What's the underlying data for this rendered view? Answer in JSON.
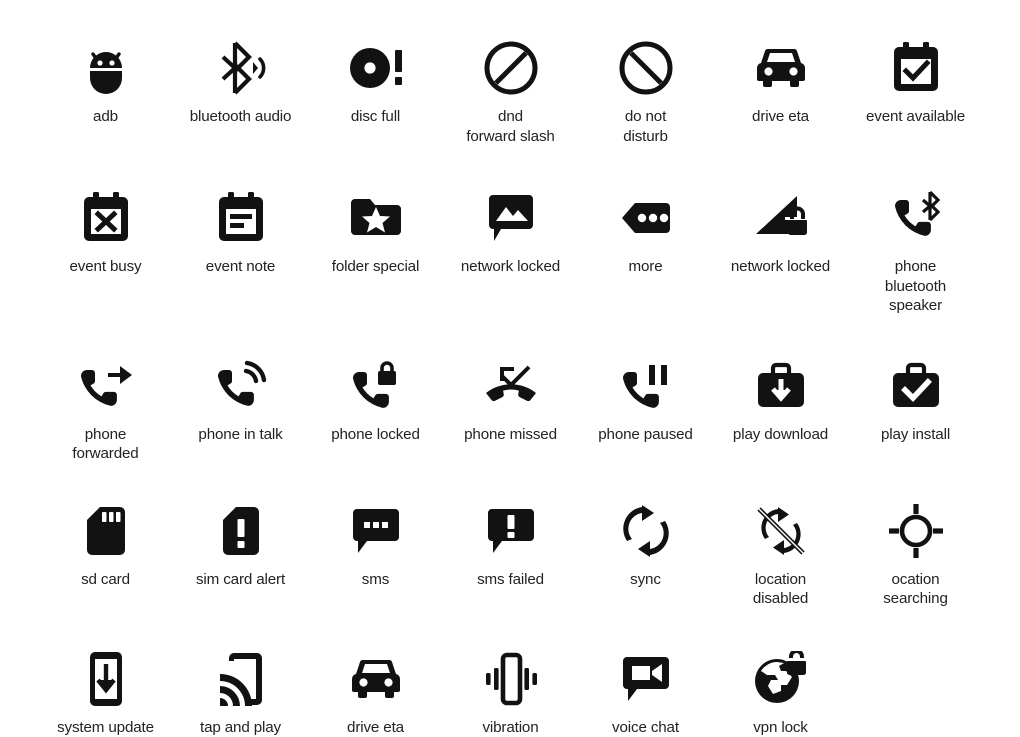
{
  "sheet": {
    "background": "#ffffff",
    "icon_color": "#121212",
    "caption_color": "#232323",
    "columns": 7,
    "rows": 5
  },
  "rows": [
    {
      "items": [
        {
          "icon": "adb-icon",
          "label": "adb"
        },
        {
          "icon": "bluetooth-audio-icon",
          "label": "bluetooth audio"
        },
        {
          "icon": "disc-full-icon",
          "label": "disc full"
        },
        {
          "icon": "dnd-forward-slash-icon",
          "label": "dnd\nforward slash"
        },
        {
          "icon": "do-not-disturb-icon",
          "label": "do not\ndisturb"
        },
        {
          "icon": "drive-eta-icon",
          "label": "drive eta"
        },
        {
          "icon": "event-available-icon",
          "label": "event available"
        }
      ]
    },
    {
      "items": [
        {
          "icon": "event-busy-icon",
          "label": "event busy"
        },
        {
          "icon": "event-note-icon",
          "label": "event note"
        },
        {
          "icon": "folder-special-icon",
          "label": "folder special"
        },
        {
          "icon": "network-locked-image-icon",
          "label": "network locked"
        },
        {
          "icon": "more-icon",
          "label": "more"
        },
        {
          "icon": "network-locked-signal-icon",
          "label": "network locked"
        },
        {
          "icon": "phone-bluetooth-speaker-icon",
          "label": "phone\nbluetooth\nspeaker"
        }
      ]
    },
    {
      "items": [
        {
          "icon": "phone-forwarded-icon",
          "label": "phone\nforwarded"
        },
        {
          "icon": "phone-in-talk-icon",
          "label": "phone in talk"
        },
        {
          "icon": "phone-locked-icon",
          "label": "phone locked"
        },
        {
          "icon": "phone-missed-icon",
          "label": "phone missed"
        },
        {
          "icon": "phone-paused-icon",
          "label": "phone paused"
        },
        {
          "icon": "play-download-icon",
          "label": "play download"
        },
        {
          "icon": "play-install-icon",
          "label": "play install"
        }
      ]
    },
    {
      "items": [
        {
          "icon": "sd-card-icon",
          "label": "sd card"
        },
        {
          "icon": "sim-card-alert-icon",
          "label": "sim card alert"
        },
        {
          "icon": "sms-icon",
          "label": "sms"
        },
        {
          "icon": "sms-failed-icon",
          "label": "sms failed"
        },
        {
          "icon": "sync-icon",
          "label": "sync"
        },
        {
          "icon": "location-disabled-icon",
          "label": "location\ndisabled"
        },
        {
          "icon": "location-searching-icon",
          "label": "ocation\nsearching"
        }
      ]
    },
    {
      "items": [
        {
          "icon": "system-update-icon",
          "label": "system update"
        },
        {
          "icon": "tap-and-play-icon",
          "label": "tap and play"
        },
        {
          "icon": "drive-eta-icon",
          "label": "drive eta"
        },
        {
          "icon": "vibration-icon",
          "label": "vibration"
        },
        {
          "icon": "voice-chat-icon",
          "label": "voice chat"
        },
        {
          "icon": "vpn-lock-icon",
          "label": "vpn lock"
        }
      ]
    }
  ]
}
